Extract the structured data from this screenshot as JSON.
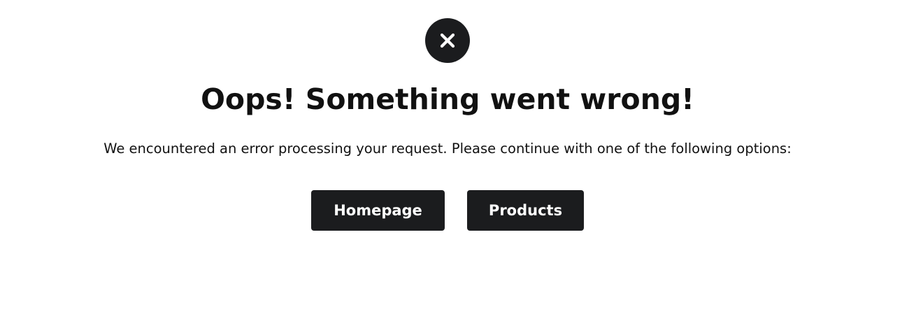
{
  "error": {
    "icon": "close-icon",
    "title": "Oops! Something went wrong!",
    "message": "We encountered an error processing your request. Please continue with one of the following options:"
  },
  "actions": {
    "homepage_label": "Homepage",
    "products_label": "Products"
  },
  "colors": {
    "button_bg": "#1b1c1e",
    "button_text": "#ffffff",
    "text": "#111111",
    "background": "#ffffff"
  }
}
